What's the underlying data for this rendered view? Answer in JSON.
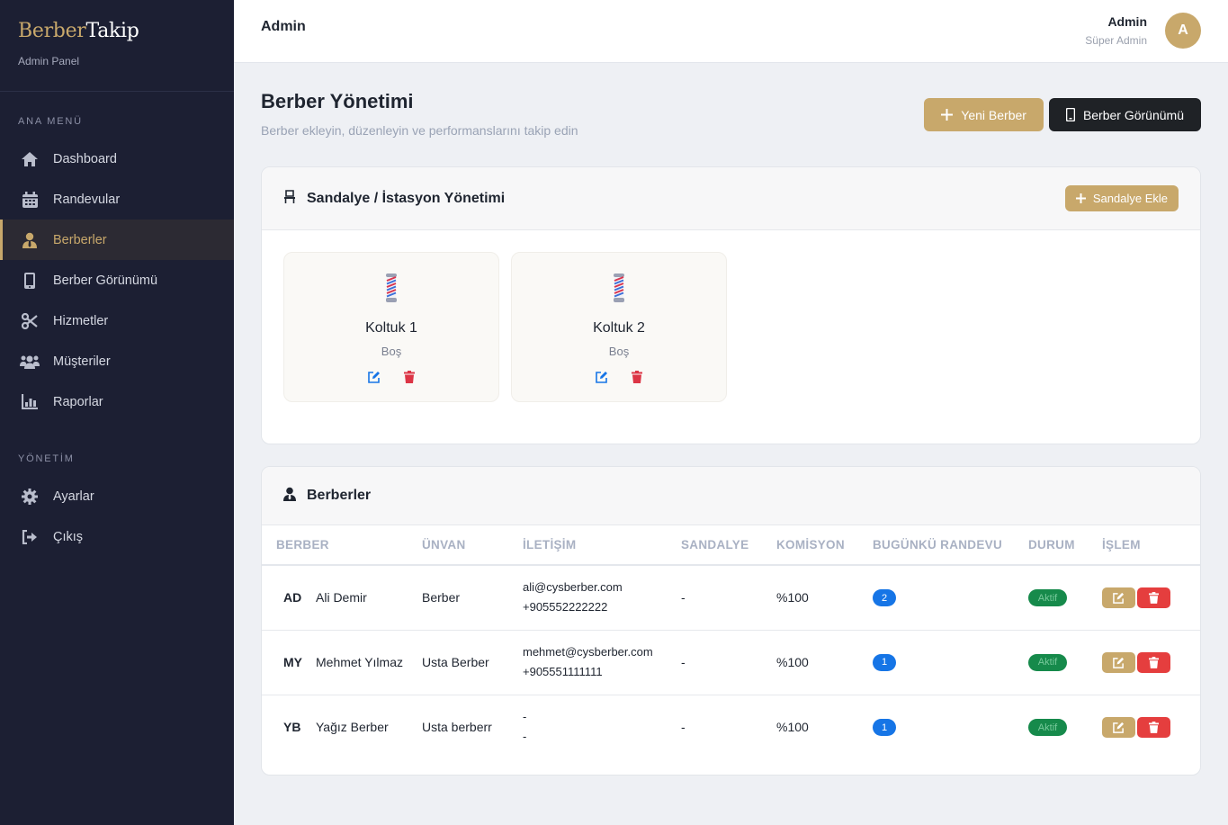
{
  "sidebar": {
    "brand_part1": "Berber",
    "brand_part2": "Takip",
    "brand_sub": "Admin Panel",
    "section_main": "ANA MENÜ",
    "main_items": [
      {
        "label": "Dashboard",
        "icon": "home-icon"
      },
      {
        "label": "Randevular",
        "icon": "calendar-icon"
      },
      {
        "label": "Berberler",
        "icon": "user-tie-icon",
        "active": true
      },
      {
        "label": "Berber Görünümü",
        "icon": "mobile-icon"
      },
      {
        "label": "Hizmetler",
        "icon": "scissors-icon"
      },
      {
        "label": "Müşteriler",
        "icon": "users-icon"
      },
      {
        "label": "Raporlar",
        "icon": "chart-icon"
      }
    ],
    "section_admin": "YÖNETİM",
    "admin_items": [
      {
        "label": "Ayarlar",
        "icon": "gear-icon"
      },
      {
        "label": "Çıkış",
        "icon": "logout-icon"
      }
    ]
  },
  "topbar": {
    "title": "Admin",
    "user_name": "Admin",
    "user_role": "Süper Admin",
    "avatar_letter": "A"
  },
  "page": {
    "title": "Berber Yönetimi",
    "subtitle": "Berber ekleyin, düzenleyin ve performanslarını takip edin",
    "new_barber_label": "Yeni Berber",
    "barber_view_label": "Berber Görünümü"
  },
  "chairs_card": {
    "title": "Sandalye / İstasyon Yönetimi",
    "add_label": "Sandalye Ekle",
    "chairs": [
      {
        "name": "Koltuk 1",
        "status": "Boş"
      },
      {
        "name": "Koltuk 2",
        "status": "Boş"
      }
    ]
  },
  "barbers_card": {
    "title": "Berberler",
    "columns": [
      "BERBER",
      "ÜNVAN",
      "İLETİŞİM",
      "SANDALYE",
      "KOMİSYON",
      "BUGÜNKÜ RANDEVU",
      "DURUM",
      "İŞLEM"
    ],
    "rows": [
      {
        "initials": "AD",
        "name": "Ali Demir",
        "title": "Berber",
        "email": "ali@cysberber.com",
        "phone": "+905552222222",
        "chair": "-",
        "commission": "%100",
        "today": "2",
        "status": "Aktif"
      },
      {
        "initials": "MY",
        "name": "Mehmet Yılmaz",
        "title": "Usta Berber",
        "email": "mehmet@cysberber.com",
        "phone": "+905551111111",
        "chair": "-",
        "commission": "%100",
        "today": "1",
        "status": "Aktif"
      },
      {
        "initials": "YB",
        "name": "Yağız Berber",
        "title": "Usta berberr",
        "email": "-",
        "phone": "-",
        "chair": "-",
        "commission": "%100",
        "today": "1",
        "status": "Aktif"
      }
    ]
  },
  "colors": {
    "sidebar_bg": "#1c1f33",
    "gold": "#c8a86b",
    "dark_button": "#1f2226",
    "badge_blue": "#1675e6",
    "badge_green": "#168a4b",
    "danger": "#e53e3e"
  }
}
